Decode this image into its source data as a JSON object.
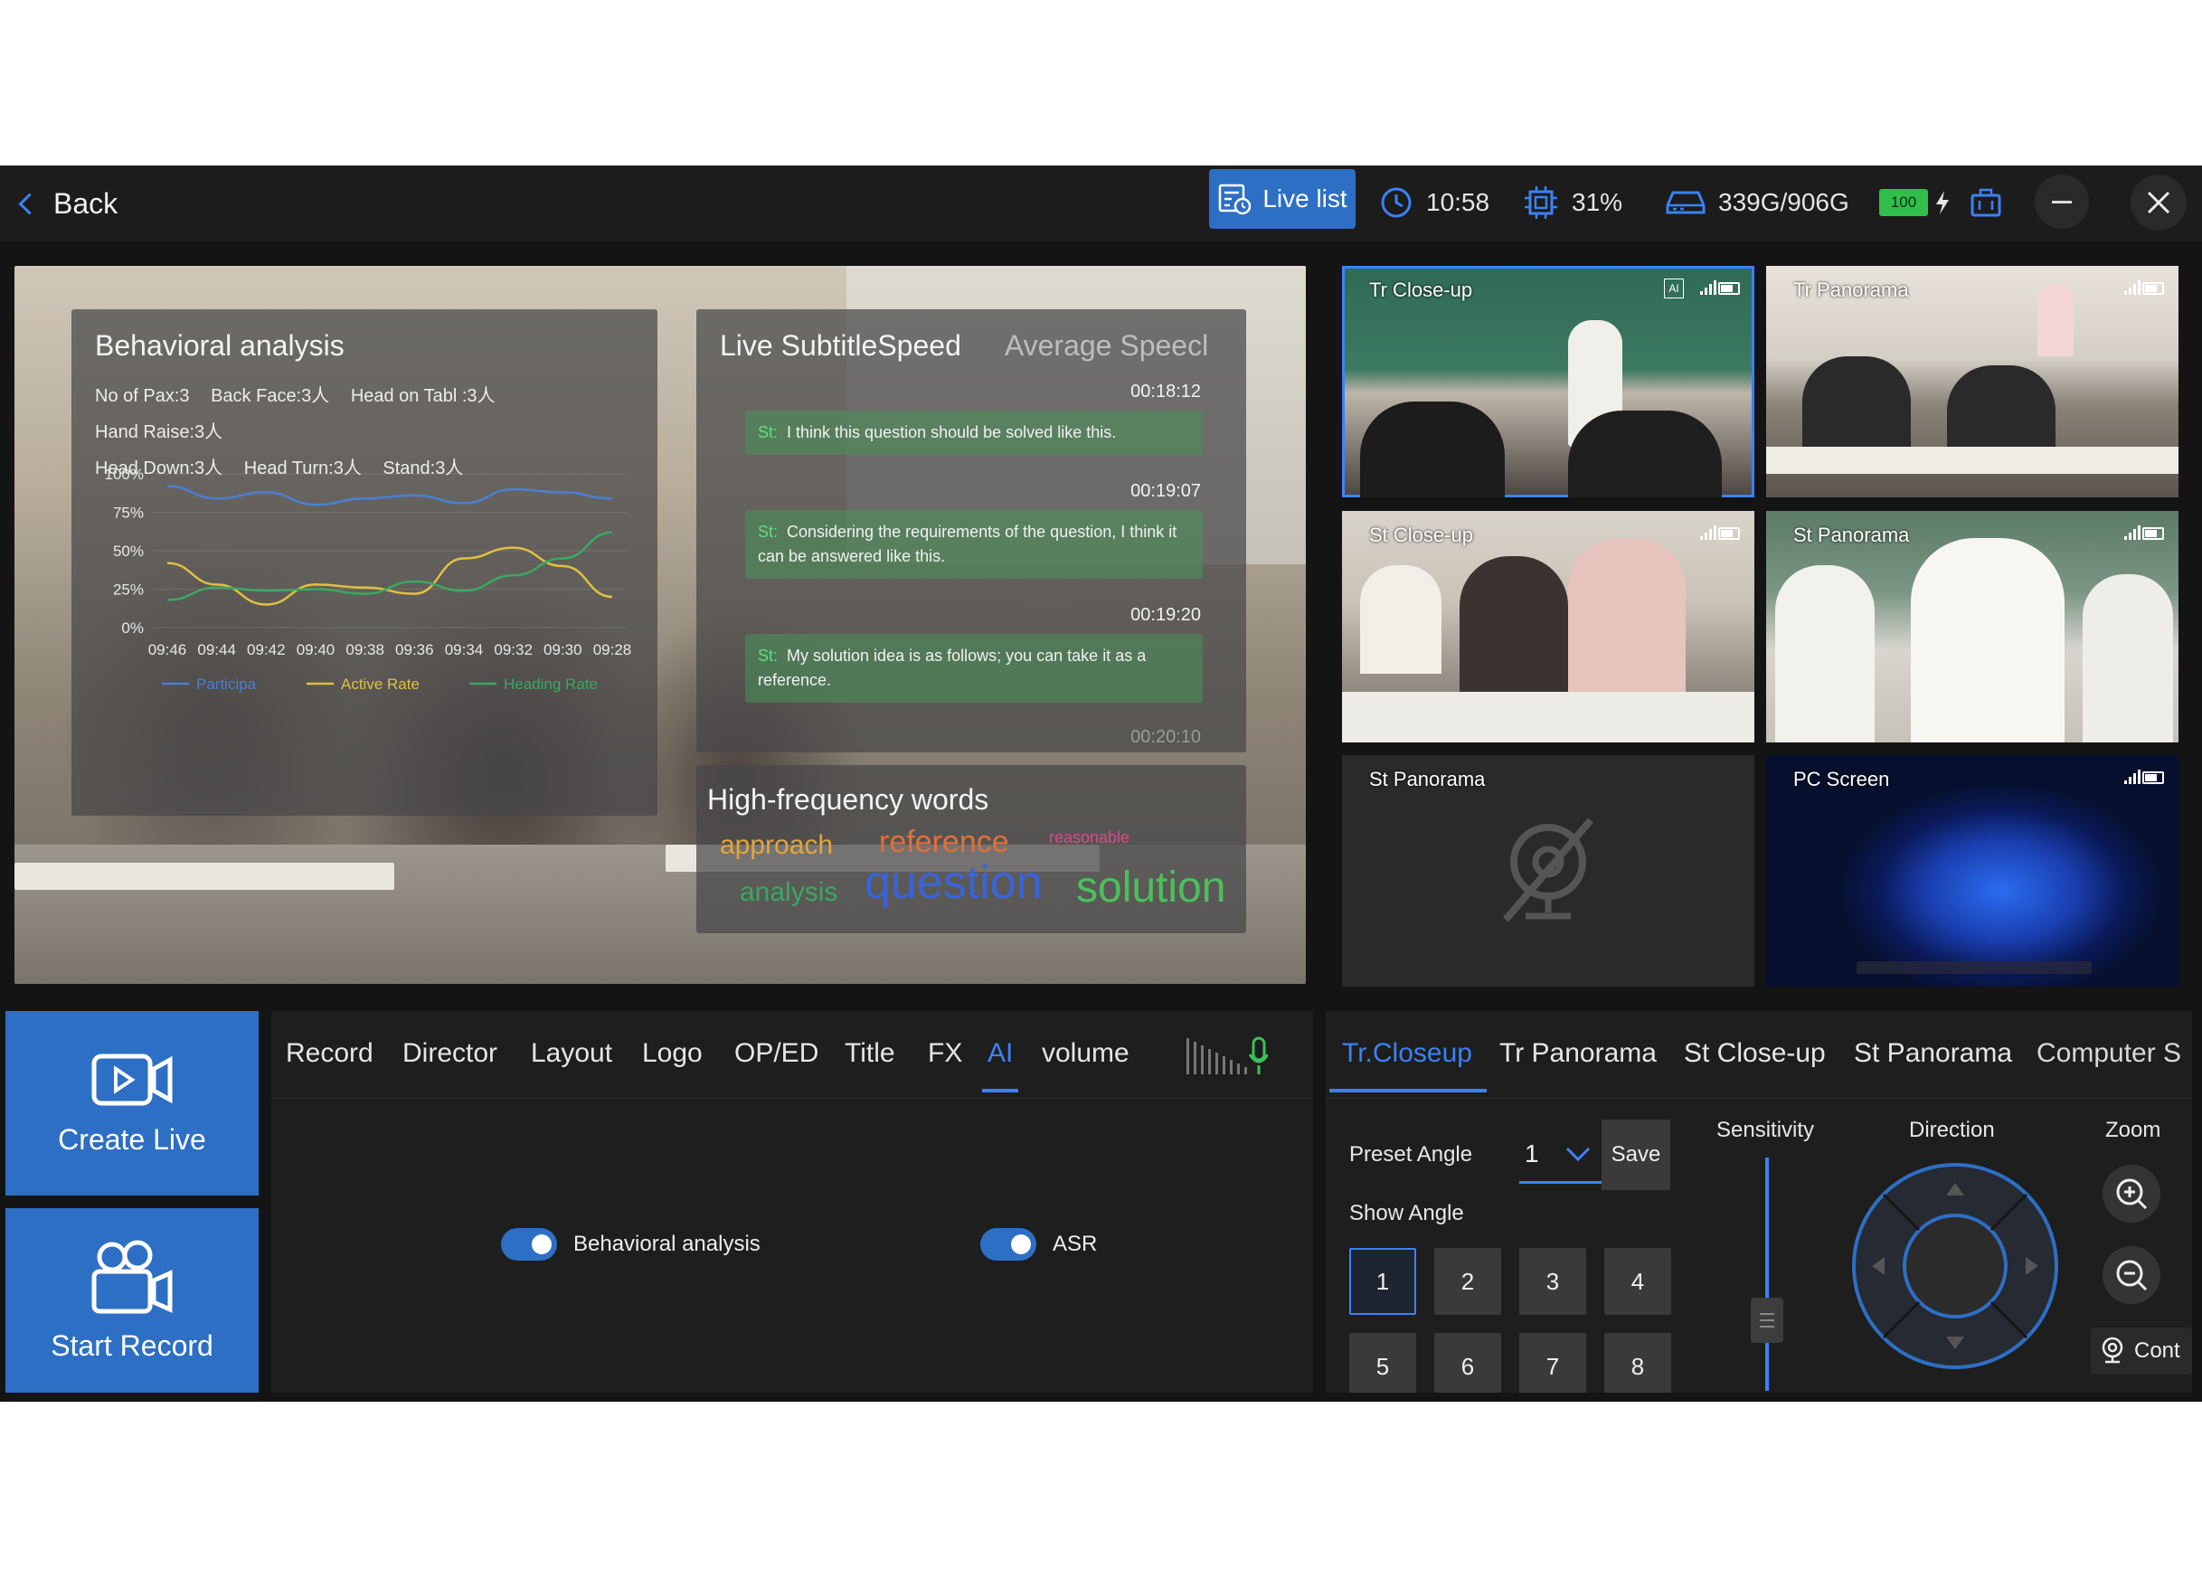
{
  "colors": {
    "accent": "#3b82f6",
    "primary_button": "#2d6fc4",
    "background": "#141414",
    "panel": "#1e1e1e"
  },
  "topbar": {
    "back_label": "Back",
    "live_list_label": "Live list",
    "time": "10:58",
    "cpu": "31%",
    "storage": "339G/906G",
    "battery": "100"
  },
  "preview": {
    "behavioral": {
      "title": "Behavioral analysis",
      "stats": [
        "No of Pax:3",
        "Back Face:3人",
        "Head on Tabl :3人",
        "Hand Raise:3人",
        "Head Down:3人",
        "Head Turn:3人",
        "Stand:3人"
      ]
    },
    "subtitles": {
      "title": "Live SubtitleSpeed",
      "title_2": "Average Speecl",
      "entries": [
        {
          "time": "00:18:12",
          "speaker": "St:",
          "text": "I think this question should be solved like this."
        },
        {
          "time": "00:19:07",
          "speaker": "St:",
          "text": "Considering the requirements of the question, I think it can be answered like this."
        },
        {
          "time": "00:19:20",
          "speaker": "St:",
          "text": "My solution idea is as follows; you can take it as a reference."
        },
        {
          "time": "00:20:10"
        }
      ]
    },
    "words": {
      "title": "High-frequency words",
      "items": [
        "approach",
        "reference",
        "reasonable",
        "analysis",
        "question",
        "solution"
      ]
    }
  },
  "chart_data": {
    "type": "line",
    "x": [
      "09:46",
      "09:44",
      "09:42",
      "09:40",
      "09:38",
      "09:36",
      "09:34",
      "09:32",
      "09:30",
      "09:28"
    ],
    "yticks": [
      "100%",
      "75%",
      "50%",
      "25%",
      "0%"
    ],
    "ylim": [
      0,
      100
    ],
    "series": [
      {
        "name": "Participa",
        "color": "#4a7fd4",
        "values": [
          92,
          84,
          88,
          80,
          84,
          86,
          81,
          90,
          88,
          84
        ]
      },
      {
        "name": "Active Rate",
        "color": "#e0c040",
        "values": [
          42,
          28,
          15,
          28,
          26,
          22,
          45,
          52,
          40,
          20
        ]
      },
      {
        "name": "Heading Rate",
        "color": "#3aa860",
        "values": [
          18,
          26,
          24,
          25,
          22,
          30,
          24,
          34,
          45,
          62
        ]
      }
    ],
    "legend_position": "bottom"
  },
  "cameras": [
    {
      "label": "Tr Close-up"
    },
    {
      "label": "Tr Panorama"
    },
    {
      "label": "St Close-up"
    },
    {
      "label": "St Panorama"
    },
    {
      "label": "St Panorama"
    },
    {
      "label": "PC Screen"
    }
  ],
  "actions": {
    "create_live": "Create Live",
    "start_record": "Start Record"
  },
  "control_tabs": [
    "Record",
    "Director",
    "Layout",
    "Logo",
    "OP/ED",
    "Title",
    "FX",
    "AI",
    "volume"
  ],
  "toggles": {
    "behavioral": "Behavioral analysis",
    "asr": "ASR"
  },
  "ptz": {
    "tabs": [
      "Tr.Closeup",
      "Tr Panorama",
      "St Close-up",
      "St Panorama",
      "Computer S"
    ],
    "preset_angle_label": "Preset Angle",
    "preset_value": "1",
    "save_label": "Save",
    "show_angle_label": "Show Angle",
    "angles": [
      "1",
      "2",
      "3",
      "4",
      "5",
      "6",
      "7",
      "8"
    ],
    "sensitivity_label": "Sensitivity",
    "direction_label": "Direction",
    "zoom_label": "Zoom",
    "cont_label": "Cont"
  }
}
